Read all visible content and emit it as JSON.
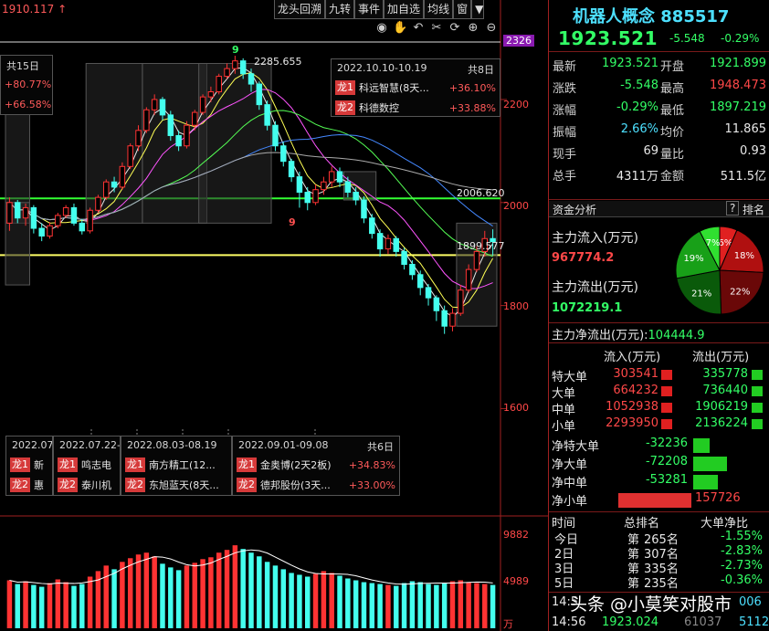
{
  "toolbar": {
    "price_readout": "1910.117",
    "buttons": [
      "龙头回溯",
      "九转",
      "事件",
      "加自选",
      "均线",
      "窗"
    ],
    "arrow": "▼",
    "icons": [
      "eye-icon",
      "hand-icon",
      "undo-icon",
      "scissors-icon",
      "reset-icon",
      "zoom-in-icon",
      "zoom-out-icon"
    ]
  },
  "chart_data": {
    "type": "candlestick",
    "y_ticks": [
      2326,
      2200,
      2000,
      1800,
      1600
    ],
    "ylim": [
      1560,
      2340
    ],
    "volume_ticks": [
      "9882",
      "4989",
      "万"
    ],
    "annotations": {
      "high": "2285.655",
      "ma_2006": "2006.620",
      "ma_1899": "1899.577",
      "nine_marks": [
        "9",
        "9"
      ]
    },
    "hlines": [
      {
        "value": 2008,
        "color": "#33ff33"
      },
      {
        "value": 1898,
        "color": "#ffff66"
      }
    ],
    "candles": [
      [
        1960,
        2000,
        1945,
        2010
      ],
      [
        2000,
        1970,
        1960,
        2005
      ],
      [
        1970,
        1990,
        1955,
        1998
      ],
      [
        1990,
        1950,
        1940,
        1995
      ],
      [
        1950,
        1935,
        1925,
        1960
      ],
      [
        1935,
        1955,
        1930,
        1962
      ],
      [
        1955,
        1975,
        1950,
        1980
      ],
      [
        1975,
        1990,
        1970,
        1995
      ],
      [
        1990,
        1960,
        1955,
        1998
      ],
      [
        1960,
        1945,
        1938,
        1968
      ],
      [
        1945,
        1985,
        1940,
        1990
      ],
      [
        1985,
        2010,
        1980,
        2015
      ],
      [
        2010,
        2040,
        2005,
        2045
      ],
      [
        2040,
        2030,
        2020,
        2050
      ],
      [
        2030,
        2070,
        2025,
        2078
      ],
      [
        2070,
        2110,
        2065,
        2115
      ],
      [
        2110,
        2140,
        2100,
        2150
      ],
      [
        2140,
        2180,
        2135,
        2185
      ],
      [
        2180,
        2200,
        2170,
        2210
      ],
      [
        2200,
        2170,
        2160,
        2205
      ],
      [
        2170,
        2130,
        2120,
        2178
      ],
      [
        2130,
        2110,
        2100,
        2140
      ],
      [
        2110,
        2150,
        2105,
        2158
      ],
      [
        2150,
        2175,
        2140,
        2180
      ],
      [
        2175,
        2205,
        2170,
        2210
      ],
      [
        2205,
        2215,
        2195,
        2225
      ],
      [
        2215,
        2245,
        2210,
        2250
      ],
      [
        2245,
        2260,
        2240,
        2270
      ],
      [
        2260,
        2275,
        2250,
        2285
      ],
      [
        2275,
        2250,
        2240,
        2280
      ],
      [
        2250,
        2230,
        2215,
        2260
      ],
      [
        2230,
        2190,
        2180,
        2235
      ],
      [
        2190,
        2150,
        2140,
        2198
      ],
      [
        2150,
        2110,
        2100,
        2158
      ],
      [
        2110,
        2080,
        2070,
        2118
      ],
      [
        2080,
        2050,
        2040,
        2085
      ],
      [
        2050,
        2020,
        1990,
        2060
      ],
      [
        2020,
        2000,
        1985,
        2030
      ],
      [
        2000,
        2025,
        1995,
        2035
      ],
      [
        2025,
        2040,
        2015,
        2050
      ],
      [
        2040,
        2060,
        2030,
        2070
      ],
      [
        2060,
        2040,
        2030,
        2068
      ],
      [
        2040,
        2020,
        2010,
        2050
      ],
      [
        2020,
        2005,
        1995,
        2030
      ],
      [
        2005,
        1970,
        1960,
        2012
      ],
      [
        1970,
        1940,
        1930,
        1978
      ],
      [
        1940,
        1910,
        1895,
        1948
      ],
      [
        1910,
        1930,
        1900,
        1938
      ],
      [
        1930,
        1905,
        1895,
        1935
      ],
      [
        1905,
        1880,
        1870,
        1912
      ],
      [
        1880,
        1860,
        1850,
        1888
      ],
      [
        1860,
        1835,
        1820,
        1868
      ],
      [
        1835,
        1815,
        1800,
        1842
      ],
      [
        1815,
        1790,
        1770,
        1820
      ],
      [
        1790,
        1760,
        1745,
        1800
      ],
      [
        1760,
        1785,
        1750,
        1795
      ],
      [
        1785,
        1830,
        1780,
        1840
      ],
      [
        1830,
        1870,
        1825,
        1880
      ],
      [
        1870,
        1905,
        1865,
        1915
      ],
      [
        1905,
        1930,
        1895,
        1945
      ],
      [
        1930,
        1924,
        1897,
        1948
      ]
    ],
    "volumes": [
      5200,
      4800,
      5100,
      4700,
      4500,
      4900,
      5300,
      5000,
      4600,
      4800,
      5600,
      6200,
      6800,
      6400,
      7200,
      7600,
      8000,
      8200,
      7800,
      7000,
      6600,
      6300,
      6800,
      7100,
      7500,
      7700,
      8200,
      8500,
      9000,
      8600,
      8200,
      7800,
      7200,
      6800,
      6400,
      6000,
      5800,
      5600,
      5900,
      6200,
      6000,
      5700,
      5400,
      5200,
      5000,
      4900,
      4800,
      4700,
      4600,
      4900,
      5100,
      5000,
      4800,
      4700,
      4900,
      5100,
      5200,
      5000,
      4900,
      4800,
      4700
    ],
    "interval_boxes": [
      {
        "from": 0,
        "to": 2,
        "header": "2022.07",
        "count": "共15日",
        "r1_name": "新",
        "r1_pct": "",
        "r2_name": "惠",
        "r2_pct": ""
      },
      {
        "from": 10,
        "to": 16,
        "header": "2022.07.22-",
        "count": "",
        "r1_name": "鸣志电",
        "r1_pct": "",
        "r2_name": "泰川机",
        "r2_pct": ""
      },
      {
        "from": 17,
        "to": 24,
        "header": "2022.08.03-08.19",
        "count": "",
        "r1_name": "南方精工(12...",
        "r1_pct": "",
        "r2_name": "东旭蓝天(8天...",
        "r2_pct": ""
      },
      {
        "from": 24,
        "to": 32,
        "header": "2022.09.01-09.08",
        "count": "共6日",
        "r1_name": "金奥博(2天2板)",
        "r1_pct": "+34.83%",
        "r2_name": "德邦股份(3天...",
        "r2_pct": "+33.00%"
      }
    ],
    "top_box": {
      "header": "2022.10.10-10.19",
      "count": "共8日",
      "r1_name": "科远智慧(8天...",
      "r1_pct": "+36.10%",
      "r2_name": "科德数控",
      "r2_pct": "+33.88%"
    },
    "left_box": {
      "count": "共15日",
      "p1": "+80.77%",
      "p2": "+66.58%"
    }
  },
  "panel": {
    "title": "机器人概念 885517",
    "price": "1923.521",
    "chg": "-5.548",
    "pct": "-0.29%",
    "stats": [
      {
        "k1": "最新",
        "v1": "1923.521",
        "c1": "green",
        "k2": "开盘",
        "v2": "1921.899",
        "c2": "green"
      },
      {
        "k1": "涨跌",
        "v1": "-5.548",
        "c1": "green",
        "k2": "最高",
        "v2": "1948.473",
        "c2": "red"
      },
      {
        "k1": "涨幅",
        "v1": "-0.29%",
        "c1": "green",
        "k2": "最低",
        "v2": "1897.219",
        "c2": "green"
      },
      {
        "k1": "振幅",
        "v1": "2.66%",
        "c1": "cyan",
        "k2": "均价",
        "v2": "11.865",
        "c2": "white"
      },
      {
        "k1": "现手",
        "v1": "69",
        "c1": "white",
        "k2": "量比",
        "v2": "0.93",
        "c2": "white"
      },
      {
        "k1": "总手",
        "v1": "4311万",
        "c1": "white",
        "k2": "金额",
        "v2": "511.5亿",
        "c2": "white"
      }
    ],
    "section": {
      "title": "资金分析",
      "help": "?",
      "rank": "排名"
    },
    "inflow_label": "主力流入(万元)",
    "inflow_value": "967774.2",
    "outflow_label": "主力流出(万元)",
    "outflow_value": "1072219.1",
    "net_label": "主力净流出(万元):",
    "net_value": "104444.9",
    "pie": [
      {
        "label": "6%",
        "pct": 6,
        "color": "#e02020"
      },
      {
        "label": "18%",
        "pct": 18,
        "color": "#b01010"
      },
      {
        "label": "22%",
        "pct": 22,
        "color": "#6a0808"
      },
      {
        "label": "21%",
        "pct": 21,
        "color": "#0a5a0a"
      },
      {
        "label": "19%",
        "pct": 19,
        "color": "#18a018"
      },
      {
        "label": "7%",
        "pct": 7,
        "color": "#30e030"
      }
    ],
    "flow_header": {
      "in": "流入(万元)",
      "out": "流出(万元)"
    },
    "flows": [
      {
        "name": "特大单",
        "in": "303541",
        "out": "335778"
      },
      {
        "name": "大单",
        "in": "664232",
        "out": "736440"
      },
      {
        "name": "中单",
        "in": "1052938",
        "out": "1906219"
      },
      {
        "name": "小单",
        "in": "2293950",
        "out": "2136224"
      }
    ],
    "nets": [
      {
        "name": "净特大单",
        "value": "-32236",
        "frac": 0.22,
        "color": "#22cc22"
      },
      {
        "name": "净大单",
        "value": "-72208",
        "frac": 0.46,
        "color": "#22cc22"
      },
      {
        "name": "净中单",
        "value": "-53281",
        "frac": 0.34,
        "color": "#22cc22"
      },
      {
        "name": "净小单",
        "value": "157726",
        "frac": 1.0,
        "color": "#e03030"
      }
    ],
    "rank_header": {
      "t": "时间",
      "r": "总排名",
      "n": "大单净比"
    },
    "ranks": [
      {
        "t": "今日",
        "d": "第",
        "r": "265名",
        "n": "-1.55%"
      },
      {
        "t": "2日",
        "d": "第",
        "r": "307名",
        "n": "-2.83%"
      },
      {
        "t": "3日",
        "d": "第",
        "r": "335名",
        "n": "-2.73%"
      },
      {
        "t": "5日",
        "d": "第",
        "r": "235名",
        "n": "-0.36%"
      }
    ],
    "times": [
      {
        "t": "14:5",
        "p": "",
        "v": "",
        "x": "006"
      },
      {
        "t": "14:56",
        "p": "1923.024",
        "v": "61037",
        "x": "5112"
      }
    ]
  },
  "watermark": "头条 @小莫笑对股市"
}
